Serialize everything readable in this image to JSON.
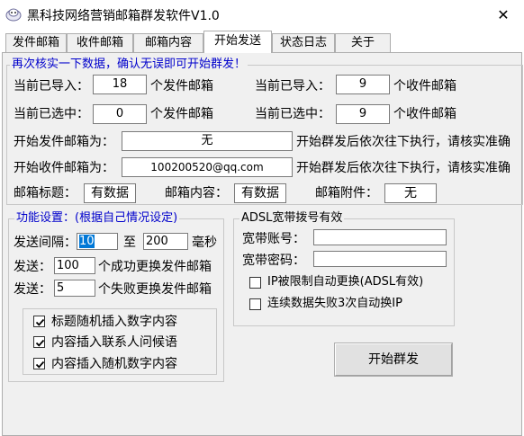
{
  "window": {
    "title": "黑科技网络营销邮箱群发软件V1.0",
    "close_glyph": "✕"
  },
  "tabs": [
    {
      "label": "发件邮箱"
    },
    {
      "label": "收件邮箱"
    },
    {
      "label": "邮箱内容"
    },
    {
      "label": "开始发送"
    },
    {
      "label": "状态日志"
    },
    {
      "label": "关于"
    }
  ],
  "confirm": {
    "legend": "再次核实一下数据，确认无误即可开始群发！",
    "imported_label": "当前已导入：",
    "imported_senders": "18",
    "sender_unit": "个发件邮箱",
    "imported_label2": "当前已导入：",
    "imported_receivers": "9",
    "receiver_unit": "个收件邮箱",
    "selected_label": "当前已选中：",
    "selected_senders": "0",
    "sender_unit2": "个发件邮箱",
    "selected_label2": "当前已选中：",
    "selected_receivers": "9",
    "receiver_unit2": "个收件邮箱",
    "start_sender_label": "开始发件邮箱为：",
    "start_sender_value": "无",
    "start_receiver_label": "开始收件邮箱为：",
    "start_receiver_value": "100200520@qq.com",
    "hint1": "开始群发后依次往下执行，请核实准确",
    "hint2": "开始群发后依次往下执行，请核实准确",
    "subject_label": "邮箱标题：",
    "subject_value": "有数据",
    "content_label": "邮箱内容：",
    "content_value": "有数据",
    "attach_label": "邮箱附件：",
    "attach_value": "无"
  },
  "settings": {
    "legend": "功能设置：(根据自己情况设定)",
    "interval_label": "发送间隔：",
    "interval_min": "10",
    "to_label": "至",
    "interval_max": "200",
    "ms_label": "毫秒",
    "send_label": "发送：",
    "success_count": "100",
    "success_text": "个成功更换发件邮箱",
    "send_label2": "发送：",
    "fail_count": "5",
    "fail_text": "个失败更换发件邮箱",
    "options": [
      {
        "label": "标题随机插入数字内容",
        "checked": true
      },
      {
        "label": "内容插入联系人问候语",
        "checked": true
      },
      {
        "label": "内容插入随机数字内容",
        "checked": true
      }
    ]
  },
  "adsl": {
    "legend": "ADSL宽带拨号有效",
    "account_label": "宽带账号：",
    "account_value": "",
    "password_label": "宽带密码：",
    "password_value": "",
    "opt1_label": "IP被限制自动更换(ADSL有效)",
    "opt1_checked": false,
    "opt2_label": "连续数据失败3次自动换IP",
    "opt2_checked": false
  },
  "start_button": "开始群发"
}
